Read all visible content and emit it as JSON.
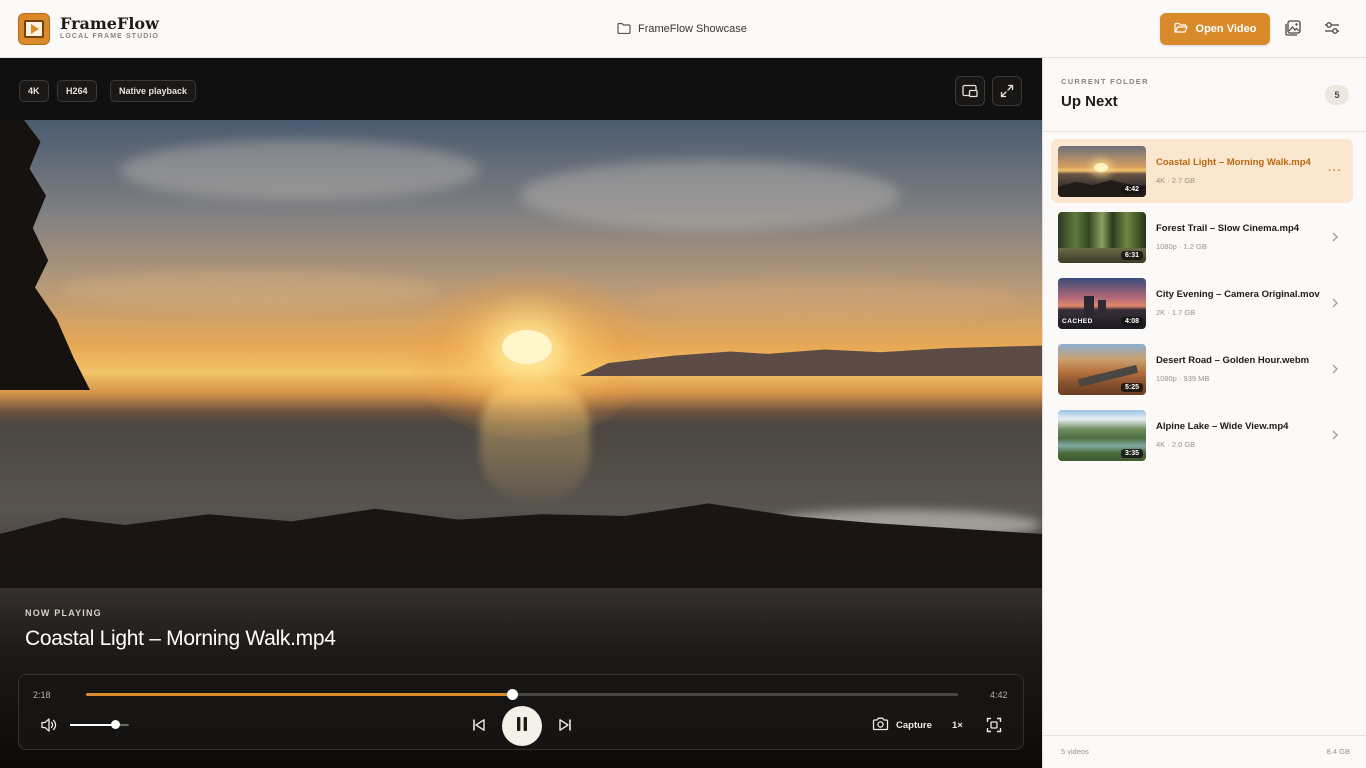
{
  "app": {
    "name": "FrameFlow",
    "subtitle": "LOCAL FRAME STUDIO",
    "folder_name": "FrameFlow Showcase",
    "open_video_label": "Open Video",
    "accent_color": "#d98a2b"
  },
  "icons": {
    "logo": "frame-play-icon",
    "folder": "folder-icon",
    "open": "folder-open-icon",
    "gallery": "image-gallery-icon",
    "settings": "sliders-icon",
    "pip": "picture-in-picture-icon",
    "fullscreen": "expand-icon",
    "volume": "speaker-icon",
    "prev": "skip-back-icon",
    "pause": "pause-icon",
    "next": "skip-forward-icon",
    "capture": "camera-icon",
    "fit": "fit-screen-icon",
    "chevron": "chevron-right-icon",
    "more": "more-dots-icon"
  },
  "player": {
    "badges": [
      "4K",
      "H264",
      "Native playback"
    ],
    "now_playing_label": "NOW PLAYING",
    "title": "Coastal Light – Morning Walk.mp4",
    "current_time": "2:18",
    "total_time": "4:42",
    "progress": 0.489,
    "volume": 0.76,
    "capture_label": "Capture",
    "speed_label": "1×"
  },
  "sidebar": {
    "section_label": "CURRENT FOLDER",
    "title": "Up Next",
    "count": "5",
    "items": [
      {
        "title": "Coastal Light – Morning Walk.mp4",
        "meta": "4K · 2.7 GB",
        "duration": "4:42",
        "active": true,
        "cached": ""
      },
      {
        "title": "Forest Trail – Slow Cinema.mp4",
        "meta": "1080p · 1.2 GB",
        "duration": "6:31",
        "active": false,
        "cached": ""
      },
      {
        "title": "City Evening – Camera Original.mov",
        "meta": "2K · 1.7 GB",
        "duration": "4:08",
        "active": false,
        "cached": "CACHED"
      },
      {
        "title": "Desert Road – Golden Hour.webm",
        "meta": "1080p · 939 MB",
        "duration": "5:25",
        "active": false,
        "cached": ""
      },
      {
        "title": "Alpine Lake – Wide View.mp4",
        "meta": "4K · 2.0 GB",
        "duration": "3:35",
        "active": false,
        "cached": ""
      }
    ],
    "footer_count": "5 videos",
    "footer_size": "8.4 GB"
  }
}
